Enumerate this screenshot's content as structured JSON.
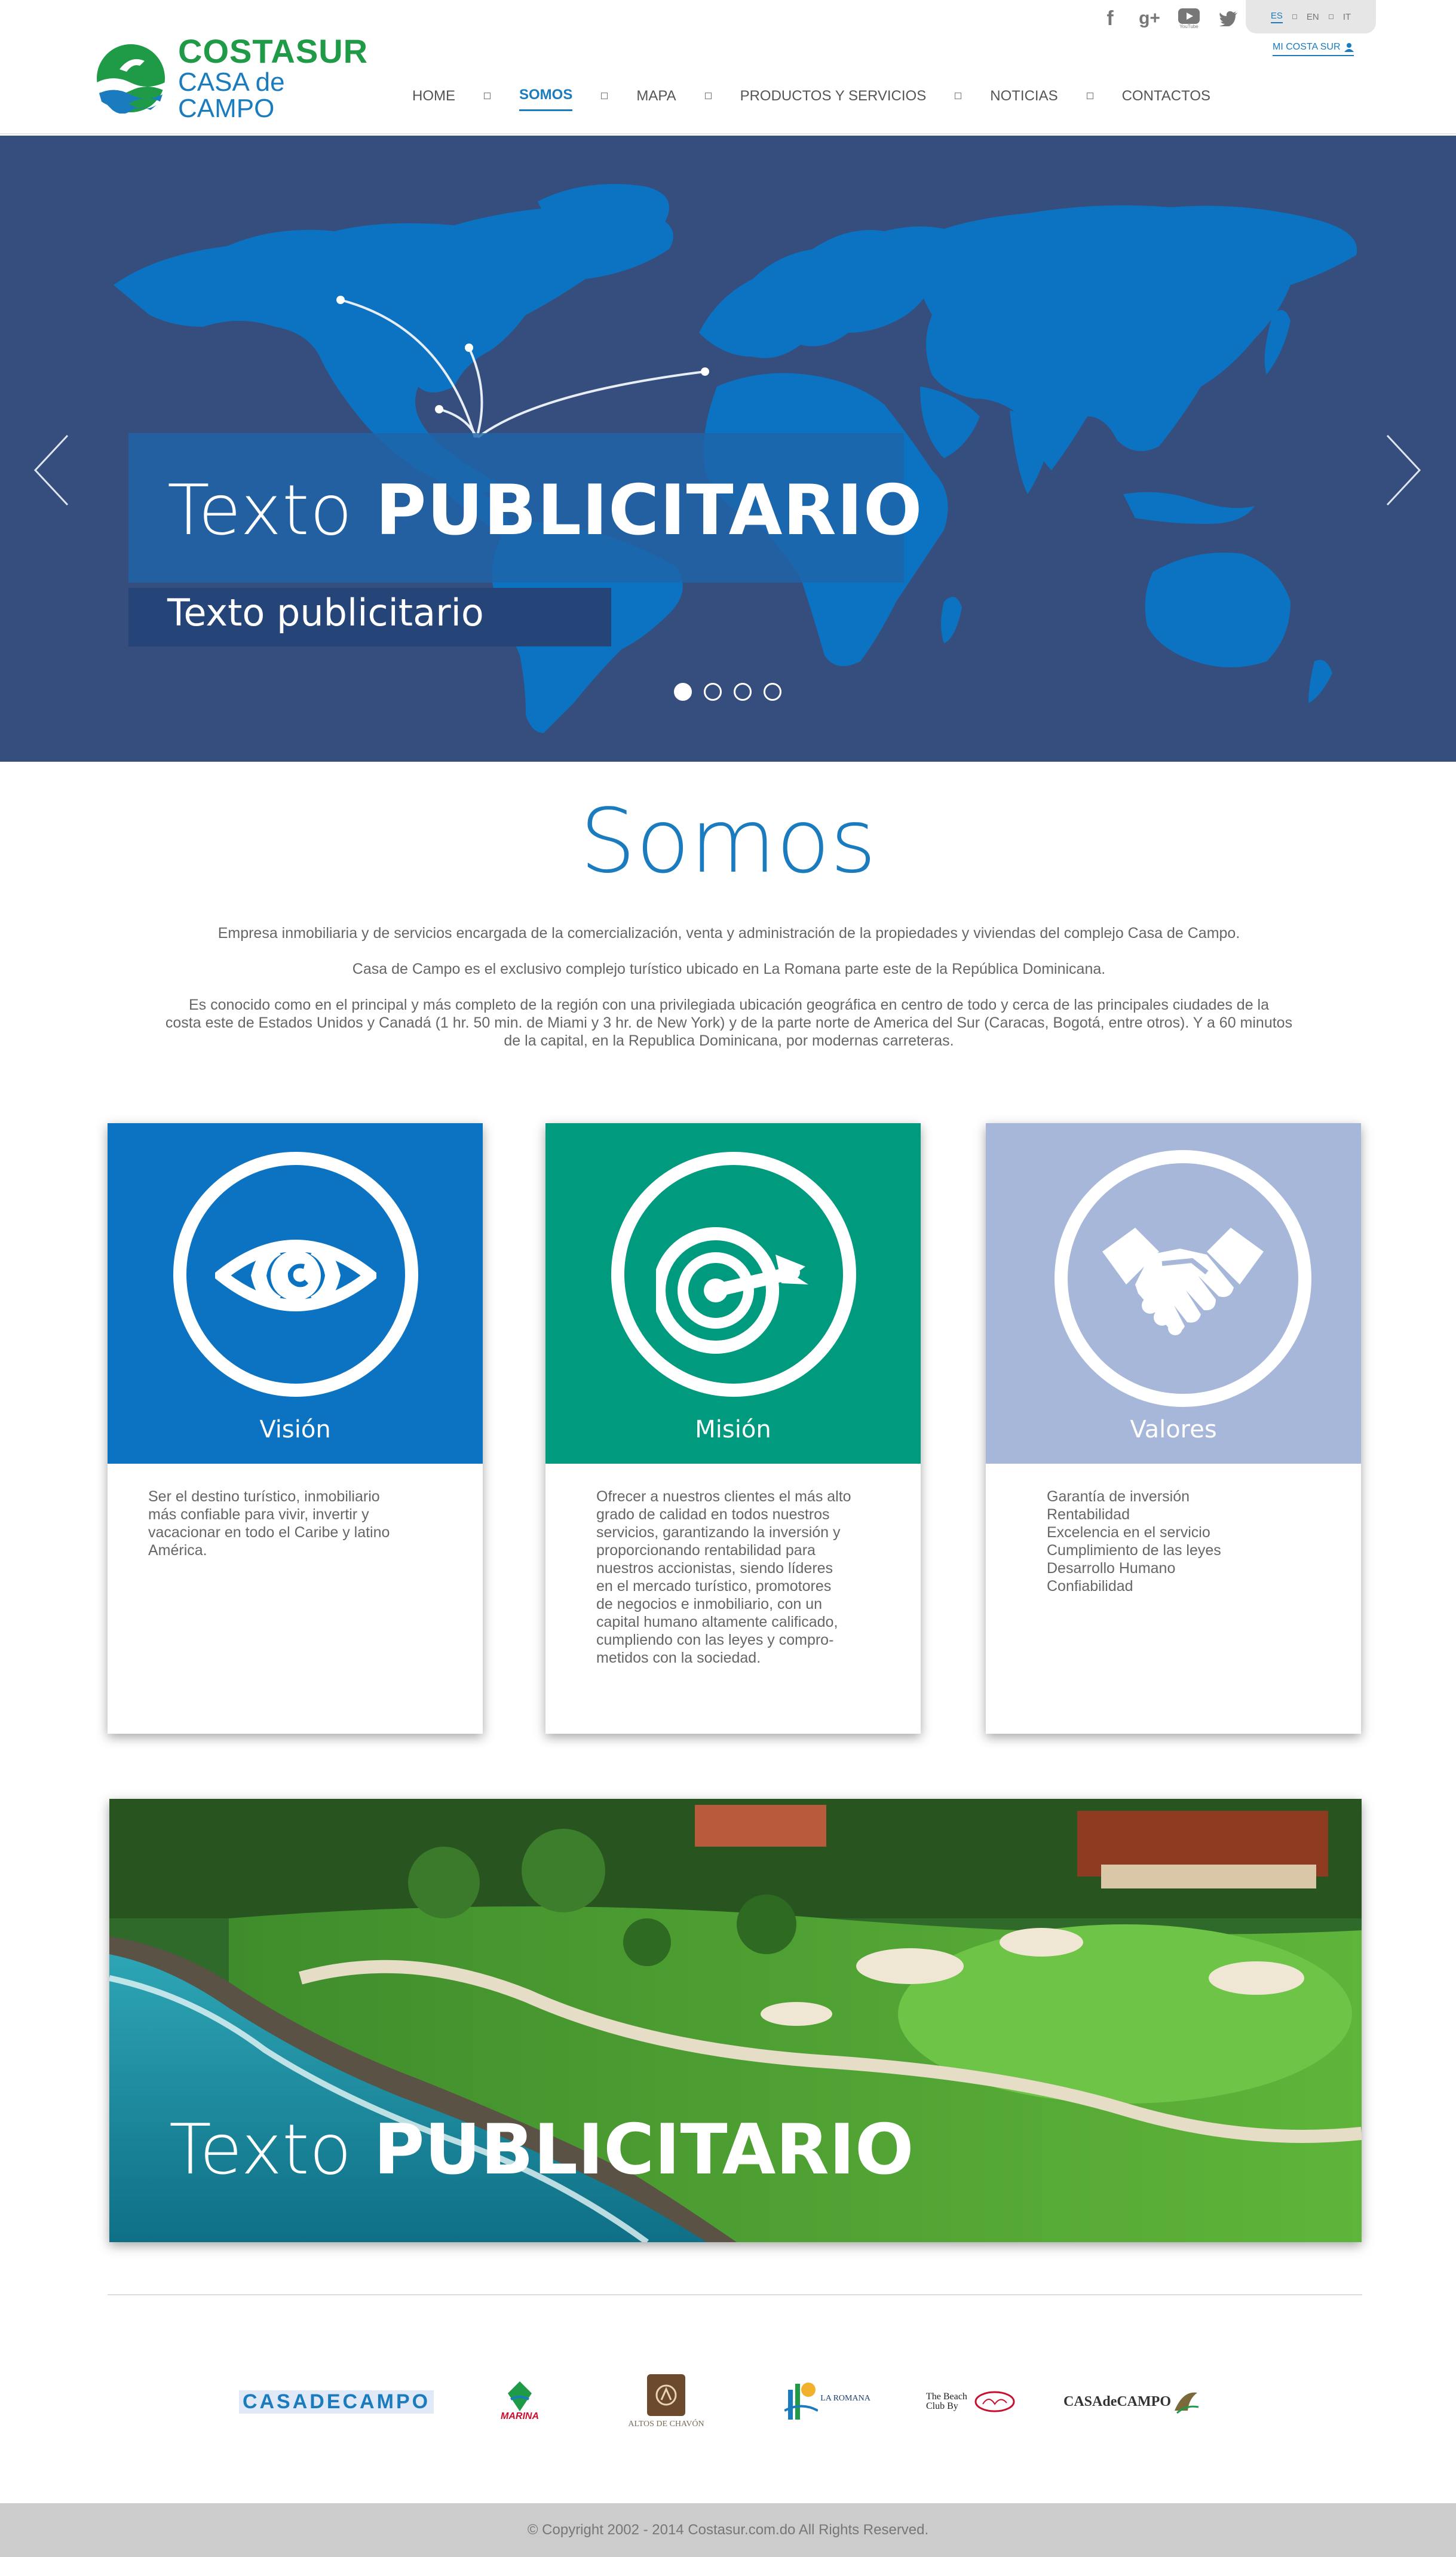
{
  "brand": {
    "line1": "COSTASUR",
    "line2": "CASA de CAMPO",
    "green": "#1f9a47",
    "blue": "#1a7cbf"
  },
  "social": [
    "facebook-icon",
    "google-plus-icon",
    "youtube-icon",
    "twitter-icon"
  ],
  "social_youtube_caption": "YouTube",
  "languages": {
    "items": [
      "ES",
      "EN",
      "IT"
    ],
    "active": "ES"
  },
  "account_link": "MI COSTA SUR",
  "nav": {
    "items": [
      "HOME",
      "SOMOS",
      "MAPA",
      "PRODUCTOS Y SERVICIOS",
      "NOTICIAS",
      "CONTACTOS"
    ],
    "active": "SOMOS"
  },
  "hero": {
    "title_light": "Texto ",
    "title_bold": "PUBLICITARIO",
    "subtitle": "Texto publicitario",
    "slides": 4,
    "active_slide": 1,
    "background": "#354e7e",
    "map_color": "#0b73c2"
  },
  "somos": {
    "title": "Somos",
    "p1": "Empresa inmobiliaria y de servicios encargada de la comercialización, venta y administración de la propiedades y viviendas del complejo Casa de Campo.",
    "p2": "Casa de Campo es el exclusivo complejo turístico ubicado en La Romana parte este de la República Dominicana.",
    "p3a": "Es conocido como en el principal y más  completo de la región con una privilegiada ubicación  geográfica en centro de todo y cerca de las principales ciudades de la",
    "p3b": "costa este de Estados Unidos y Canadá (1 hr. 50 min. de Miami y 3 hr. de New York) y de la parte norte de America del Sur (Caracas, Bogotá, entre otros). Y a 60 minutos",
    "p3c": "de la capital, en la Republica Dominicana, por modernas carreteras."
  },
  "cards": [
    {
      "title": "Visión",
      "icon": "eye-icon",
      "color": "#0b73c2",
      "lines": [
        "Ser el destino turístico, inmobiliario",
        "más confiable para vivir, invertir y",
        "vacacionar en todo el Caribe y latino",
        "América."
      ]
    },
    {
      "title": "Misión",
      "icon": "target-icon",
      "color": "#009a7e",
      "lines": [
        "Ofrecer a nuestros clientes el más alto",
        "grado de calidad en todos nuestros",
        "servicios, garantizando la inversión y",
        "proporcionando rentabilidad para",
        "nuestros accionistas, siendo líderes",
        "en el mercado turístico, promotores",
        "de negocios e inmobiliario, con un",
        "capital humano altamente calificado,",
        "cumpliendo con las leyes y compro-",
        "metidos con la sociedad."
      ]
    },
    {
      "title": "Valores",
      "icon": "handshake-icon",
      "color": "#a6b7d9",
      "lines": [
        "Garantía de inversión",
        "Rentabilidad",
        "Excelencia en el servicio",
        "Cumplimiento de las leyes",
        "Desarrollo Humano",
        "Confiabilidad"
      ]
    }
  ],
  "banner": {
    "title_light": "Texto ",
    "title_bold": "PUBLICITARIO"
  },
  "partners": [
    {
      "name": "CASADECAMPO",
      "icon": "casa-de-campo-logo"
    },
    {
      "name": "MARINA",
      "icon": "marina-logo"
    },
    {
      "name": "ALTOS DE CHAVÓN",
      "icon": "altos-de-chavon-logo"
    },
    {
      "name": "LA ROMANA",
      "icon": "la-romana-airport-logo"
    },
    {
      "name": "The Beach Club By",
      "icon": "beach-club-logo"
    },
    {
      "name": "CASAdeCAMPO",
      "icon": "casa-de-campo-spa-logo"
    }
  ],
  "footer": "© Copyright 2002 - 2014 Costasur.com.do All Rights Reserved."
}
